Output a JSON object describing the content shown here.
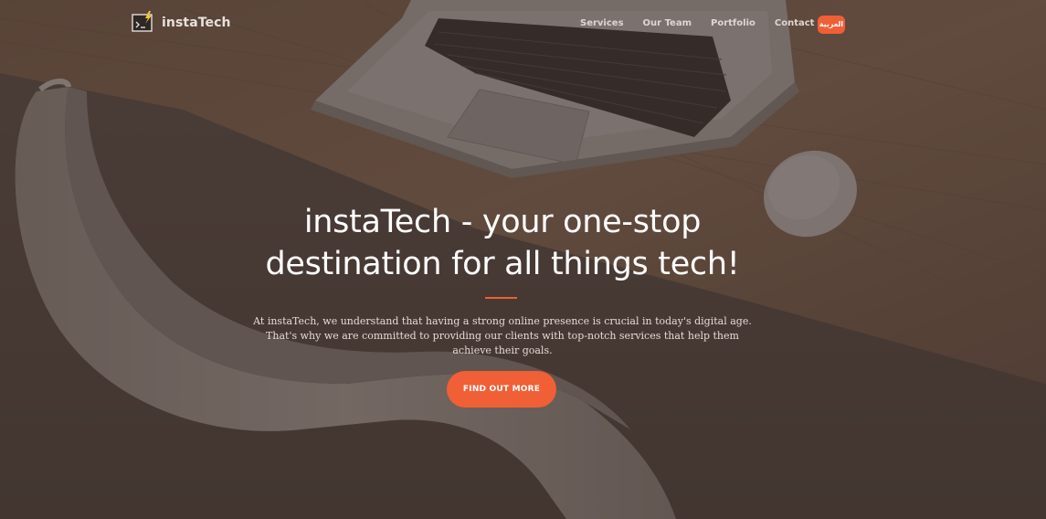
{
  "brand": {
    "name": "instaTech",
    "logo_icon": "laptop-lightning-icon"
  },
  "nav": {
    "items": [
      {
        "label": "Services"
      },
      {
        "label": "Our Team"
      },
      {
        "label": "Portfolio"
      },
      {
        "label": "Contact"
      }
    ],
    "language_button": "العربية"
  },
  "hero": {
    "headline": "instaTech - your one-stop destination for all things tech!",
    "lead": "At instaTech, we understand that having a strong online presence is crucial in today's digital age. That's why we are committed to providing our clients with top-notch services that help them achieve their goals.",
    "cta_label": "FIND OUT MORE",
    "background_description_icon": "desk-laptop-mouse-chair-photo"
  },
  "colors": {
    "accent": "#f05f35",
    "overlay": "#3e322d",
    "text_primary": "#ffffff",
    "text_muted": "#e3ddd8"
  }
}
